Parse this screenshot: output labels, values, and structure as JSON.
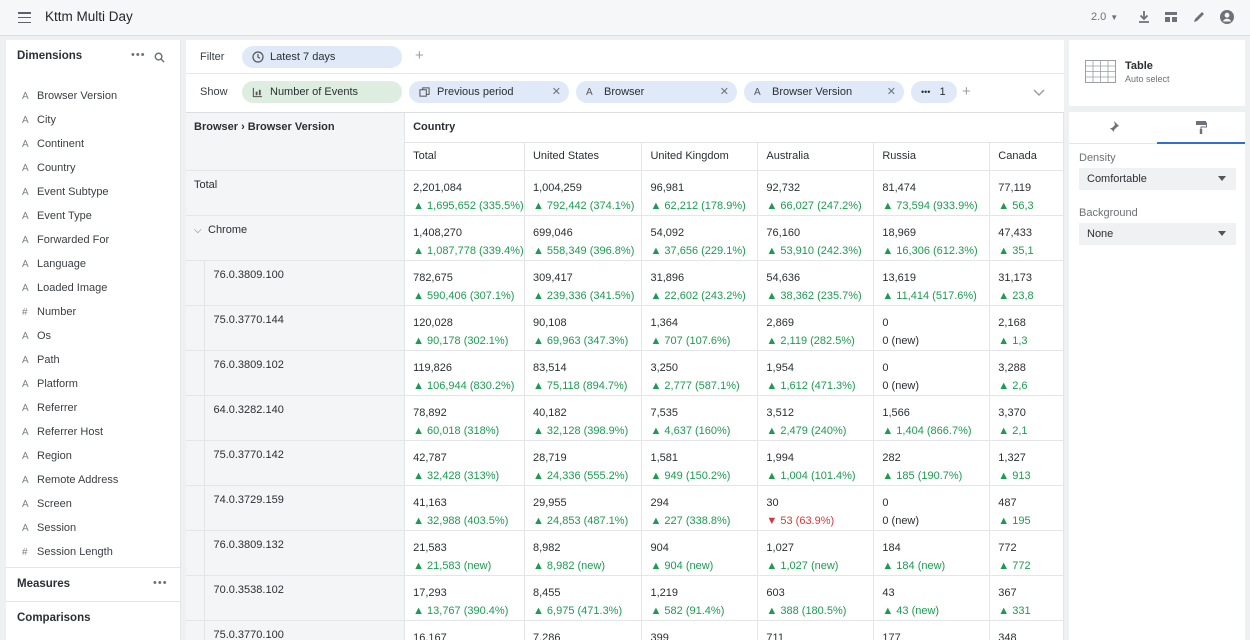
{
  "app": {
    "title": "Kttm Multi Day",
    "version": "2.0"
  },
  "dimensions": {
    "header": "Dimensions",
    "items": [
      {
        "label": "Browser Version",
        "type": "A"
      },
      {
        "label": "City",
        "type": "A"
      },
      {
        "label": "Continent",
        "type": "A"
      },
      {
        "label": "Country",
        "type": "A"
      },
      {
        "label": "Event Subtype",
        "type": "A"
      },
      {
        "label": "Event Type",
        "type": "A"
      },
      {
        "label": "Forwarded For",
        "type": "A"
      },
      {
        "label": "Language",
        "type": "A"
      },
      {
        "label": "Loaded Image",
        "type": "A"
      },
      {
        "label": "Number",
        "type": "#"
      },
      {
        "label": "Os",
        "type": "A"
      },
      {
        "label": "Path",
        "type": "A"
      },
      {
        "label": "Platform",
        "type": "A"
      },
      {
        "label": "Referrer",
        "type": "A"
      },
      {
        "label": "Referrer Host",
        "type": "A"
      },
      {
        "label": "Region",
        "type": "A"
      },
      {
        "label": "Remote Address",
        "type": "A"
      },
      {
        "label": "Screen",
        "type": "A"
      },
      {
        "label": "Session",
        "type": "A"
      },
      {
        "label": "Session Length",
        "type": "#"
      }
    ]
  },
  "measures": {
    "header": "Measures"
  },
  "comparisons": {
    "header": "Comparisons"
  },
  "filter": {
    "label": "Filter",
    "chip": "Latest 7 days"
  },
  "show": {
    "label": "Show",
    "chips": [
      "Number of Events",
      "Previous period",
      "Browser",
      "Browser Version"
    ],
    "more": "1"
  },
  "table": {
    "row_header": "Browser › Browser Version",
    "col_group": "Country",
    "columns": [
      "Total",
      "United States",
      "United Kingdom",
      "Australia",
      "Russia",
      "Canada"
    ],
    "rows": [
      {
        "label": "Total",
        "kind": "total",
        "cells": [
          [
            "2,201,084",
            "▲ 1,695,652 (335.5%)",
            "up"
          ],
          [
            "1,004,259",
            "▲ 792,442 (374.1%)",
            "up"
          ],
          [
            "96,981",
            "▲ 62,212 (178.9%)",
            "up"
          ],
          [
            "92,732",
            "▲ 66,027 (247.2%)",
            "up"
          ],
          [
            "81,474",
            "▲ 73,594 (933.9%)",
            "up"
          ],
          [
            "77,119",
            "▲ 56,3",
            "up"
          ]
        ]
      },
      {
        "label": "Chrome",
        "kind": "group",
        "cells": [
          [
            "1,408,270",
            "▲ 1,087,778 (339.4%)",
            "up"
          ],
          [
            "699,046",
            "▲ 558,349 (396.8%)",
            "up"
          ],
          [
            "54,092",
            "▲ 37,656 (229.1%)",
            "up"
          ],
          [
            "76,160",
            "▲ 53,910 (242.3%)",
            "up"
          ],
          [
            "18,969",
            "▲ 16,306 (612.3%)",
            "up"
          ],
          [
            "47,433",
            "▲ 35,1",
            "up"
          ]
        ]
      },
      {
        "label": "76.0.3809.100",
        "kind": "leaf",
        "cells": [
          [
            "782,675",
            "▲ 590,406 (307.1%)",
            "up"
          ],
          [
            "309,417",
            "▲ 239,336 (341.5%)",
            "up"
          ],
          [
            "31,896",
            "▲ 22,602 (243.2%)",
            "up"
          ],
          [
            "54,636",
            "▲ 38,362 (235.7%)",
            "up"
          ],
          [
            "13,619",
            "▲ 11,414 (517.6%)",
            "up"
          ],
          [
            "31,173",
            "▲ 23,8",
            "up"
          ]
        ]
      },
      {
        "label": "75.0.3770.144",
        "kind": "leaf",
        "cells": [
          [
            "120,028",
            "▲ 90,178 (302.1%)",
            "up"
          ],
          [
            "90,108",
            "▲ 69,963 (347.3%)",
            "up"
          ],
          [
            "1,364",
            "▲ 707 (107.6%)",
            "up"
          ],
          [
            "2,869",
            "▲ 2,119 (282.5%)",
            "up"
          ],
          [
            "0",
            "0 (new)",
            "nw"
          ],
          [
            "2,168",
            "▲ 1,3",
            "up"
          ]
        ]
      },
      {
        "label": "76.0.3809.102",
        "kind": "leaf",
        "cells": [
          [
            "119,826",
            "▲ 106,944 (830.2%)",
            "up"
          ],
          [
            "83,514",
            "▲ 75,118 (894.7%)",
            "up"
          ],
          [
            "3,250",
            "▲ 2,777 (587.1%)",
            "up"
          ],
          [
            "1,954",
            "▲ 1,612 (471.3%)",
            "up"
          ],
          [
            "0",
            "0 (new)",
            "nw"
          ],
          [
            "3,288",
            "▲ 2,6",
            "up"
          ]
        ]
      },
      {
        "label": "64.0.3282.140",
        "kind": "leaf",
        "cells": [
          [
            "78,892",
            "▲ 60,018 (318%)",
            "up"
          ],
          [
            "40,182",
            "▲ 32,128 (398.9%)",
            "up"
          ],
          [
            "7,535",
            "▲ 4,637 (160%)",
            "up"
          ],
          [
            "3,512",
            "▲ 2,479 (240%)",
            "up"
          ],
          [
            "1,566",
            "▲ 1,404 (866.7%)",
            "up"
          ],
          [
            "3,370",
            "▲ 2,1",
            "up"
          ]
        ]
      },
      {
        "label": "75.0.3770.142",
        "kind": "leaf",
        "cells": [
          [
            "42,787",
            "▲ 32,428 (313%)",
            "up"
          ],
          [
            "28,719",
            "▲ 24,336 (555.2%)",
            "up"
          ],
          [
            "1,581",
            "▲ 949 (150.2%)",
            "up"
          ],
          [
            "1,994",
            "▲ 1,004 (101.4%)",
            "up"
          ],
          [
            "282",
            "▲ 185 (190.7%)",
            "up"
          ],
          [
            "1,327",
            "▲ 913",
            "up"
          ]
        ]
      },
      {
        "label": "74.0.3729.159",
        "kind": "leaf",
        "cells": [
          [
            "41,163",
            "▲ 32,988 (403.5%)",
            "up"
          ],
          [
            "29,955",
            "▲ 24,853 (487.1%)",
            "up"
          ],
          [
            "294",
            "▲ 227 (338.8%)",
            "up"
          ],
          [
            "30",
            "▼ 53 (63.9%)",
            "dn"
          ],
          [
            "0",
            "0 (new)",
            "nw"
          ],
          [
            "487",
            "▲ 195",
            "up"
          ]
        ]
      },
      {
        "label": "76.0.3809.132",
        "kind": "leaf",
        "cells": [
          [
            "21,583",
            "▲ 21,583 (new)",
            "up"
          ],
          [
            "8,982",
            "▲ 8,982 (new)",
            "up"
          ],
          [
            "904",
            "▲ 904 (new)",
            "up"
          ],
          [
            "1,027",
            "▲ 1,027 (new)",
            "up"
          ],
          [
            "184",
            "▲ 184 (new)",
            "up"
          ],
          [
            "772",
            "▲ 772",
            "up"
          ]
        ]
      },
      {
        "label": "70.0.3538.102",
        "kind": "leaf",
        "cells": [
          [
            "17,293",
            "▲ 13,767 (390.4%)",
            "up"
          ],
          [
            "8,455",
            "▲ 6,975 (471.3%)",
            "up"
          ],
          [
            "1,219",
            "▲ 582 (91.4%)",
            "up"
          ],
          [
            "603",
            "▲ 388 (180.5%)",
            "up"
          ],
          [
            "43",
            "▲ 43 (new)",
            "up"
          ],
          [
            "367",
            "▲ 331",
            "up"
          ]
        ]
      },
      {
        "label": "75.0.3770.100",
        "kind": "leaf",
        "cells": [
          [
            "16,167",
            "",
            "up"
          ],
          [
            "7,286",
            "",
            "up"
          ],
          [
            "399",
            "",
            "up"
          ],
          [
            "711",
            "",
            "up"
          ],
          [
            "177",
            "",
            "up"
          ],
          [
            "348",
            "",
            "up"
          ]
        ]
      }
    ]
  },
  "viz": {
    "title": "Table",
    "subtitle": "Auto select"
  },
  "settings": {
    "density_label": "Density",
    "density_value": "Comfortable",
    "background_label": "Background",
    "background_value": "None"
  },
  "colors": {
    "accent_green": "#1c9b52",
    "down_red": "#d33a3a",
    "filter_chip": "#dfe9f7",
    "measure_chip": "#ddeee0"
  }
}
